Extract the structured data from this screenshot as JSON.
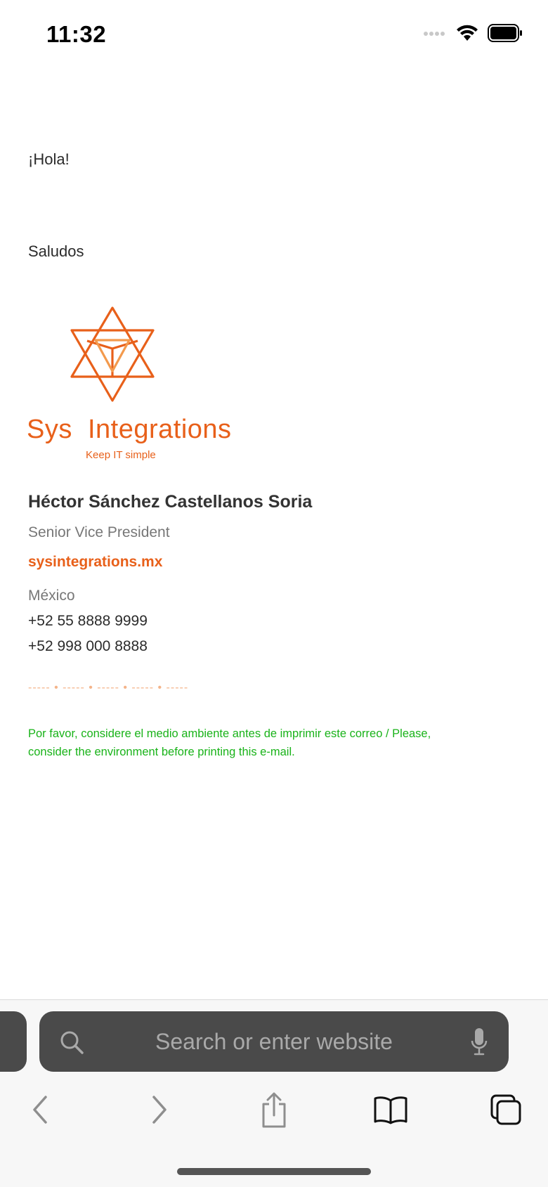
{
  "status_bar": {
    "time": "11:32"
  },
  "email": {
    "greeting": "¡Hola!",
    "closing": "Saludos",
    "brand": {
      "name": "Sys  Integrations",
      "tagline": "Keep IT simple"
    },
    "signature": {
      "name": "Héctor Sánchez Castellanos Soria",
      "title": "Senior Vice President",
      "website": "sysintegrations.mx",
      "country": "México",
      "phone_1": "+52 55 8888 9999",
      "phone_2": "+52 998 000 8888"
    },
    "divider": "----- • ----- • ----- • ----- • -----",
    "eco_note": "Por favor, considere el medio ambiente antes de imprimir este correo / Please, consider the environment before printing this e-mail."
  },
  "browser": {
    "address_placeholder": "Search or enter website",
    "icons": [
      "search-icon",
      "mic-icon",
      "back-icon",
      "forward-icon",
      "share-icon",
      "bookmarks-icon",
      "tabs-icon"
    ]
  },
  "colors": {
    "brand_orange": "#e8601a",
    "eco_green": "#19b319"
  }
}
